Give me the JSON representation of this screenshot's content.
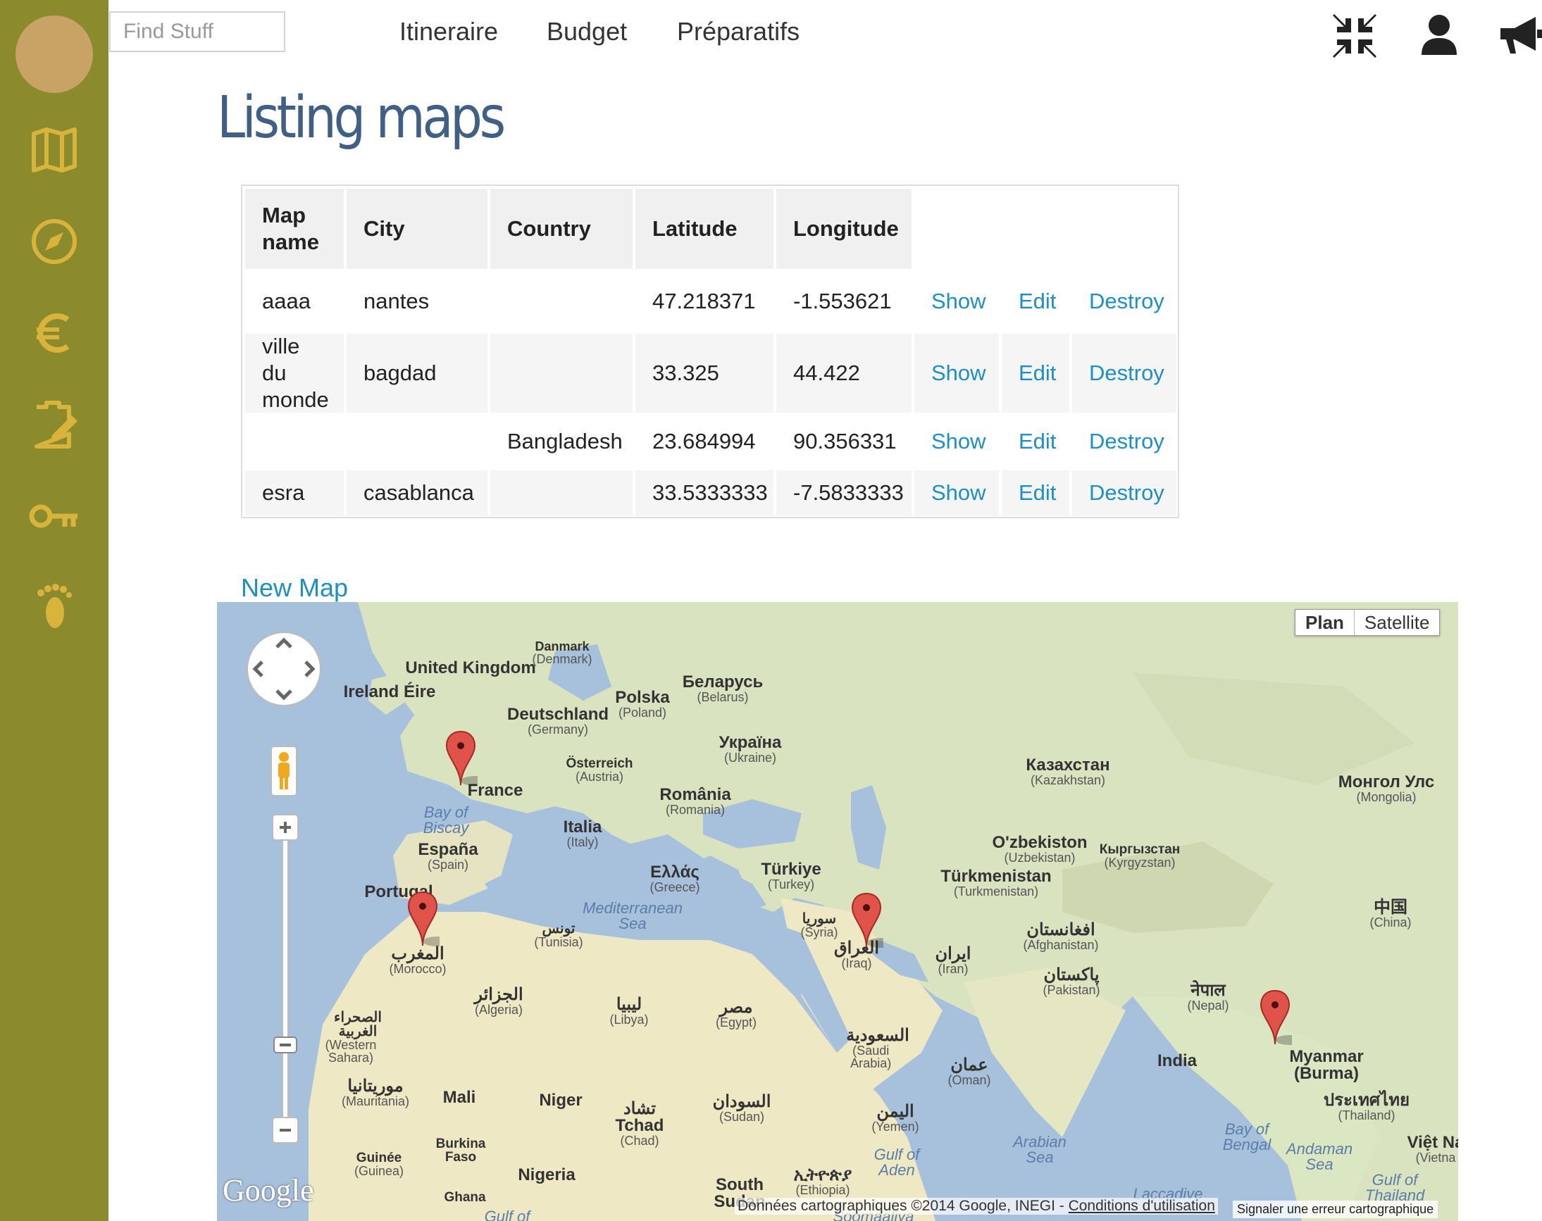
{
  "search": {
    "placeholder": "Find Stuff"
  },
  "nav": {
    "items": [
      "Itineraire",
      "Budget",
      "Préparatifs"
    ]
  },
  "top_icons": [
    "compress-icon",
    "user-icon",
    "megaphone-icon"
  ],
  "sidebar": {
    "icons": [
      "map-icon",
      "compass-icon",
      "euro-icon",
      "checklist-icon",
      "key-icon",
      "footprint-icon"
    ]
  },
  "colors": {
    "sidebar": "#8b8a2c",
    "avatar": "#c9a266",
    "title": "#3f5f86",
    "link": "#1d8fc7"
  },
  "page": {
    "title": "Listing maps"
  },
  "table": {
    "headers": [
      "Map name",
      "City",
      "Country",
      "Latitude",
      "Longitude"
    ],
    "rows": [
      {
        "map_name": "aaaa",
        "city": "nantes",
        "country": "",
        "latitude": "47.218371",
        "longitude": "-1.553621"
      },
      {
        "map_name": "ville du monde",
        "city": "bagdad",
        "country": "",
        "latitude": "33.325",
        "longitude": "44.422"
      },
      {
        "map_name": "",
        "city": "",
        "country": "Bangladesh",
        "latitude": "23.684994",
        "longitude": "90.356331"
      },
      {
        "map_name": "esra",
        "city": "casablanca",
        "country": "",
        "latitude": "33.5333333",
        "longitude": "-7.5833333"
      }
    ],
    "actions": {
      "show": "Show",
      "edit": "Edit",
      "destroy": "Destroy"
    }
  },
  "new_map": "New Map",
  "map": {
    "type_buttons": {
      "plan": "Plan",
      "satellite": "Satellite"
    },
    "logo": "Google",
    "attribution": "Données cartographiques ©2014 Google, INEGI - ",
    "terms": "Conditions d'utilisation",
    "report": "Signaler une erreur cartographique",
    "labels": [
      {
        "name": "Danmark",
        "sub": "(Denmark)"
      },
      {
        "name": "United Kingdom",
        "sub": ""
      },
      {
        "name": "Ireland Éire",
        "sub": ""
      },
      {
        "name": "Polska",
        "sub": "(Poland)"
      },
      {
        "name": "Беларусь",
        "sub": "(Belarus)"
      },
      {
        "name": "Deutschland",
        "sub": "(Germany)"
      },
      {
        "name": "Україна",
        "sub": "(Ukraine)"
      },
      {
        "name": "Österreich",
        "sub": "(Austria)"
      },
      {
        "name": "France",
        "sub": ""
      },
      {
        "name": "România",
        "sub": "(Romania)"
      },
      {
        "name": "Казахстан",
        "sub": "(Kazakhstan)"
      },
      {
        "name": "Монгол Улс",
        "sub": "(Mongolia)"
      },
      {
        "name": "Italia",
        "sub": "(Italy)"
      },
      {
        "name": "España",
        "sub": "(Spain)"
      },
      {
        "name": "Portugal",
        "sub": ""
      },
      {
        "name": "Ελλάς",
        "sub": "(Greece)"
      },
      {
        "name": "Türkiye",
        "sub": "(Turkey)"
      },
      {
        "name": "O'zbekiston",
        "sub": "(Uzbekistan)"
      },
      {
        "name": "Кыргызстан",
        "sub": "(Kyrgyzstan)"
      },
      {
        "name": "Türkmenistan",
        "sub": "(Turkmenistan)"
      },
      {
        "name": "中国",
        "sub": "(China)"
      },
      {
        "name": "تونس",
        "sub": "(Tunisia)"
      },
      {
        "name": "سوريا",
        "sub": "(Syria)"
      },
      {
        "name": "العراق",
        "sub": "(Iraq)"
      },
      {
        "name": "ایران",
        "sub": "(Iran)"
      },
      {
        "name": "افغانستان",
        "sub": "(Afghanistan)"
      },
      {
        "name": "المغرب",
        "sub": "(Morocco)"
      },
      {
        "name": "الجزائر",
        "sub": "(Algeria)"
      },
      {
        "name": "ليبيا",
        "sub": "(Libya)"
      },
      {
        "name": "مصر",
        "sub": "(Egypt)"
      },
      {
        "name": "پاکستان",
        "sub": "(Pakistan)"
      },
      {
        "name": "नेपाल",
        "sub": "(Nepal)"
      },
      {
        "name": "الصحراء الغربية",
        "sub": "(Western Sahara)"
      },
      {
        "name": "السعودية",
        "sub": "(Saudi Arabia)"
      },
      {
        "name": "India",
        "sub": ""
      },
      {
        "name": "Myanmar (Burma)",
        "sub": ""
      },
      {
        "name": "عمان",
        "sub": "(Oman)"
      },
      {
        "name": "موريتانيا",
        "sub": "(Mauritania)"
      },
      {
        "name": "Mali",
        "sub": ""
      },
      {
        "name": "Niger",
        "sub": ""
      },
      {
        "name": "تشاد Tchad",
        "sub": "(Chad)"
      },
      {
        "name": "السودان",
        "sub": "(Sudan)"
      },
      {
        "name": "اليمن",
        "sub": "(Yemen)"
      },
      {
        "name": "ประเทศไทย",
        "sub": "(Thailand)"
      },
      {
        "name": "Việt Na",
        "sub": "(Vietna"
      },
      {
        "name": "Guinée",
        "sub": "(Guinea)"
      },
      {
        "name": "Burkina Faso",
        "sub": ""
      },
      {
        "name": "Nigeria",
        "sub": ""
      },
      {
        "name": "Ghana",
        "sub": ""
      },
      {
        "name": "South Sudan",
        "sub": ""
      },
      {
        "name": "ኢትዮጵያ",
        "sub": "(Ethiopia)"
      }
    ],
    "seas": [
      "Bay of Biscay",
      "Mediterranean Sea",
      "Gulf of Aden",
      "Arabian Sea",
      "Bay of Bengal",
      "Andaman Sea",
      "Gulf of Thailand",
      "Laccadive",
      "Gulf of",
      "Soomaaliya"
    ]
  }
}
